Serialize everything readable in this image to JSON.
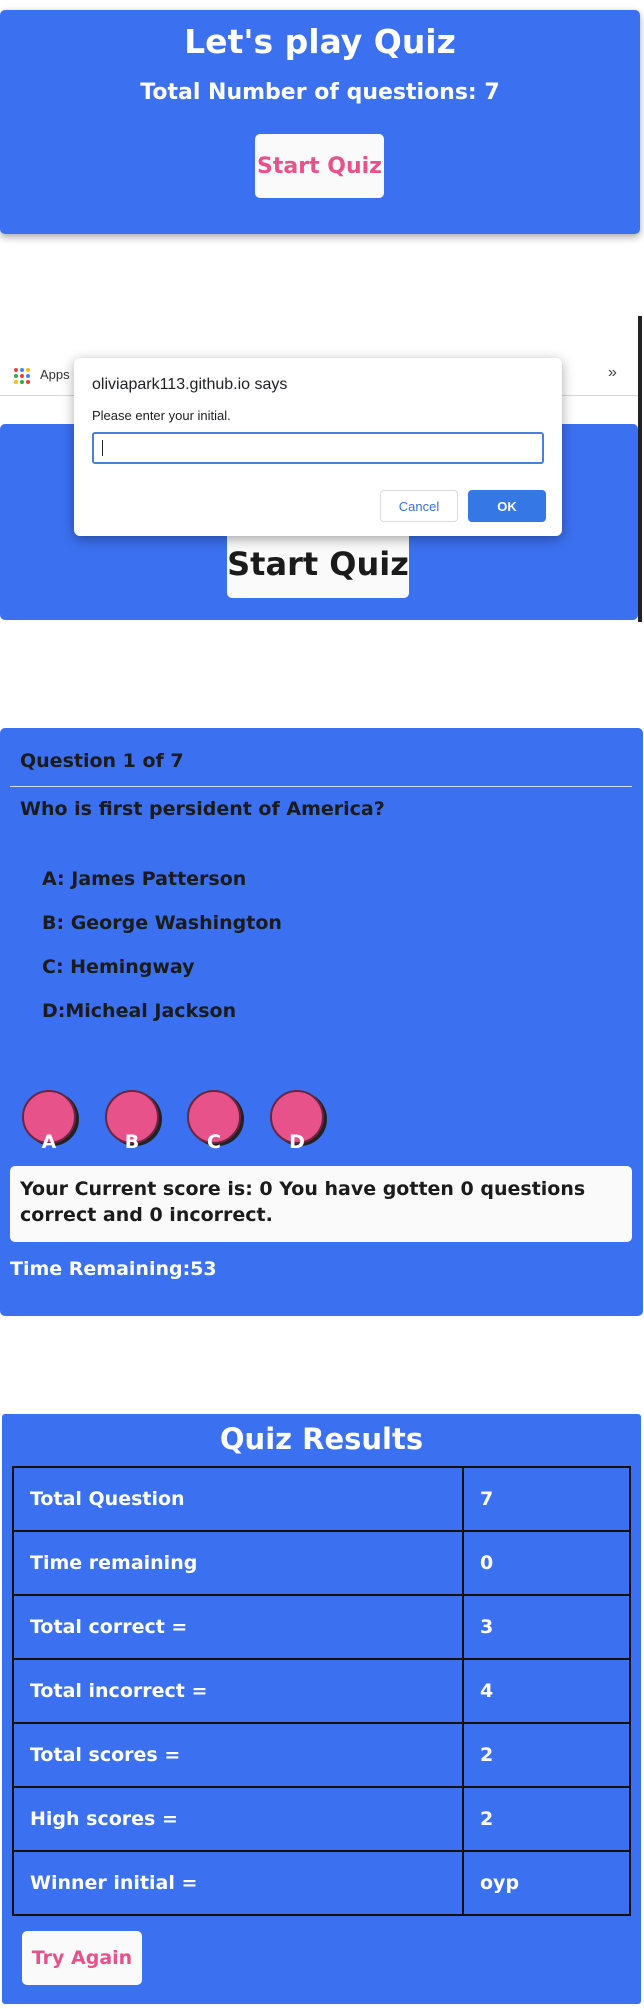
{
  "start_screen": {
    "title": "Let's play Quiz",
    "subtitle": "Total Number of questions: 7",
    "start_button": "Start Quiz"
  },
  "prompt_screen": {
    "bookmarks_label": "Apps",
    "overflow_chevron": "»",
    "dialog": {
      "title": "oliviapark113.github.io says",
      "message": "Please enter your initial.",
      "input_value": "",
      "cancel_label": "Cancel",
      "ok_label": "OK"
    },
    "start_button": "Start Quiz"
  },
  "question_screen": {
    "counter": "Question 1 of 7",
    "question": "Who is first persident of America?",
    "options": [
      "A: James Patterson",
      "B: George Washington",
      "C: Hemingway",
      "D:Micheal Jackson"
    ],
    "answer_buttons": [
      "A",
      "B",
      "C",
      "D"
    ],
    "score_text": "Your Current score is: 0 You have gotten 0 questions correct and 0 incorrect.",
    "time_remaining": "Time Remaining:53"
  },
  "results_screen": {
    "title": "Quiz Results",
    "rows": [
      {
        "label": "Total Question",
        "value": "7"
      },
      {
        "label": "Time remaining",
        "value": "0"
      },
      {
        "label": "Total correct =",
        "value": "3"
      },
      {
        "label": "Total incorrect =",
        "value": "4"
      },
      {
        "label": "Total scores =",
        "value": "2"
      },
      {
        "label": "High scores =",
        "value": "2"
      },
      {
        "label": "Winner initial =",
        "value": "oyp"
      }
    ],
    "try_again_button": "Try Again"
  },
  "colors": {
    "panel_blue": "#3b70f0",
    "accent_pink": "#e8528a",
    "dialog_ok_blue": "#3578e5"
  }
}
